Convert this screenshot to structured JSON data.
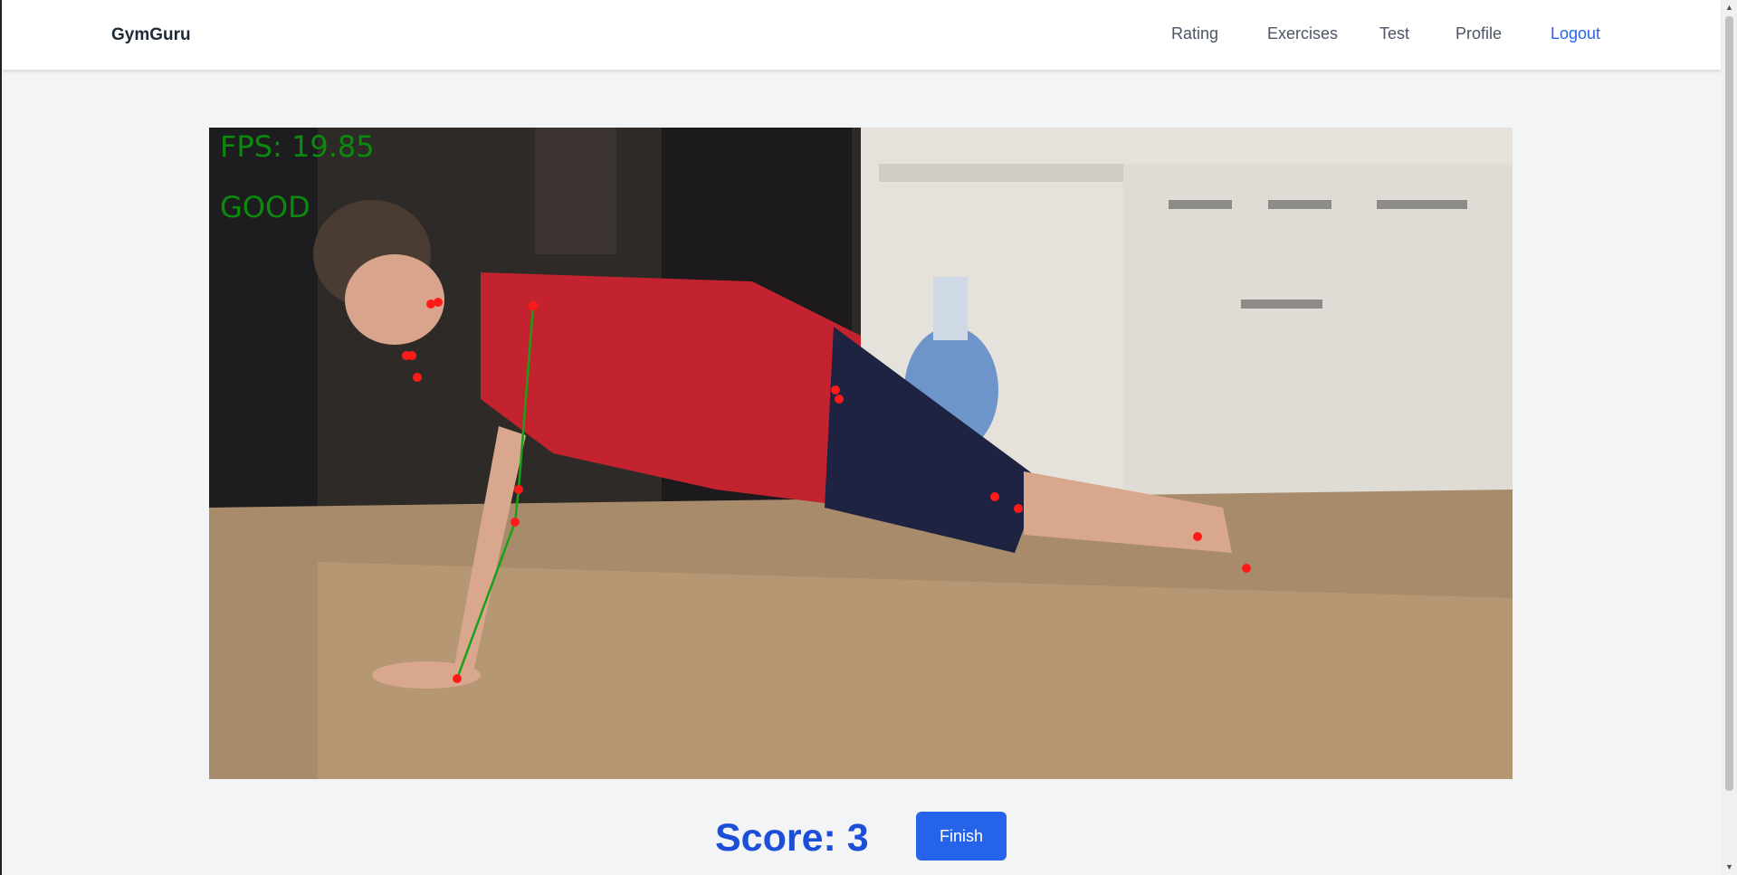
{
  "header": {
    "brand": "GymGuru",
    "nav": [
      {
        "label": "Rating",
        "name": "rating"
      },
      {
        "label": "Exercises",
        "name": "exercises"
      },
      {
        "label": "Test",
        "name": "test"
      },
      {
        "label": "Profile",
        "name": "profile"
      },
      {
        "label": "Logout",
        "name": "logout"
      }
    ]
  },
  "video": {
    "fps_text": "FPS: 19.85",
    "status_text": "GOOD"
  },
  "footer": {
    "score_text": "Score: 3",
    "finish_label": "Finish"
  },
  "colors": {
    "accent": "#2563eb",
    "score": "#1d4ed8",
    "overlay_text": "#0b8a0b",
    "keypoint": "#ff1a1a",
    "skeleton_line": "#1aa11a"
  }
}
